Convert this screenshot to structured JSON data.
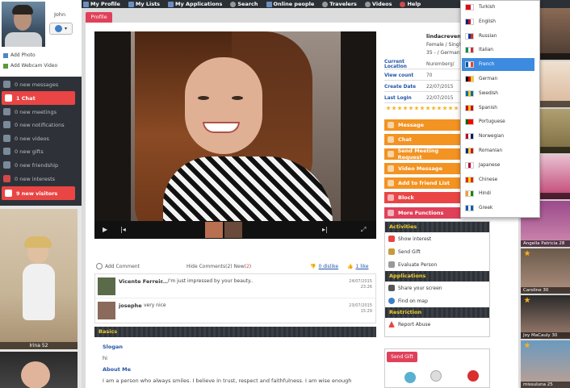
{
  "nav": {
    "items": [
      {
        "label": "My Profile",
        "icon": "user-icon"
      },
      {
        "label": "My Lists",
        "icon": "list-icon"
      },
      {
        "label": "My Applications",
        "icon": "apps-icon"
      },
      {
        "label": "Search",
        "icon": "search-icon"
      },
      {
        "label": "Online people",
        "icon": "people-icon"
      },
      {
        "label": "Travelers",
        "icon": "plane-icon"
      },
      {
        "label": "Videos",
        "icon": "video-icon"
      },
      {
        "label": "Help",
        "icon": "help-icon"
      }
    ]
  },
  "user": {
    "name": "John",
    "add_photo": "Add Photo",
    "add_webcam": "Add Webcam Video"
  },
  "menu": {
    "items": [
      {
        "label": "0 new messages",
        "highlight": false
      },
      {
        "label": "1 Chat",
        "highlight": true
      },
      {
        "label": "0 new meetings",
        "highlight": false
      },
      {
        "label": "0 new notifications",
        "highlight": false
      },
      {
        "label": "0 new videos",
        "highlight": false
      },
      {
        "label": "0 new gifts",
        "highlight": false
      },
      {
        "label": "0 new friendship",
        "highlight": false
      },
      {
        "label": "0 new interests",
        "highlight": false
      },
      {
        "label": "9 new visitors",
        "highlight": true
      }
    ]
  },
  "left_thumbs": [
    {
      "caption": "Irina 52"
    }
  ],
  "profile": {
    "tab": "Profile",
    "name": "lindacreven",
    "line1": "Female / Single",
    "line2": "35 - / Germany",
    "fields": [
      {
        "key": "Current Location",
        "value": "Nuremberg/"
      },
      {
        "key": "View count",
        "value": "70"
      },
      {
        "key": "Create Date",
        "value": "22/07/2015"
      },
      {
        "key": "Last Login",
        "value": "22/07/2015"
      }
    ]
  },
  "actions": [
    {
      "label": "Message",
      "style": "orange",
      "icon": "message-icon"
    },
    {
      "label": "Chat",
      "style": "orange",
      "icon": "chat-icon"
    },
    {
      "label": "Send Meeting Request",
      "style": "orange",
      "icon": "meeting-icon"
    },
    {
      "label": "Video Message",
      "style": "orange",
      "icon": "video-message-icon"
    },
    {
      "label": "Add to friend List",
      "style": "orange",
      "icon": "add-friend-icon"
    },
    {
      "label": "Block",
      "style": "red",
      "icon": "block-icon"
    },
    {
      "label": "More Functions",
      "style": "more",
      "icon": "more-icon"
    }
  ],
  "activities": {
    "title": "Activities",
    "items": [
      "Show interest",
      "Send Gift",
      "Evaluate Person"
    ]
  },
  "applications": {
    "title": "Applications",
    "items": [
      "Share your screen",
      "Find on map"
    ]
  },
  "restriction": {
    "title": "Restriction",
    "items": [
      "Report Abuse"
    ]
  },
  "send_gift": "Send Gift",
  "comment_bar": {
    "add": "Add Comment",
    "hide": "Hide Comments(",
    "count": "2",
    "new_label": ") New(",
    "new_count": "2",
    "close": ")",
    "dislike": "0 dislike",
    "like": "1 like"
  },
  "comments": [
    {
      "name": "Vicente Ferreir...",
      "text": "I'm just impressed by your beauty..",
      "date": "24/07/2015",
      "time": "23:26"
    },
    {
      "name": "josephe",
      "text": "very nice",
      "date": "23/07/2015",
      "time": "15:29"
    }
  ],
  "basics": {
    "title": "Basics",
    "slogan_label": "Slogan",
    "slogan": "hi",
    "about_label": "About Me",
    "about": "I am a person who always smiles. I believe in trust, respect and faithfulness. I am wise enough"
  },
  "right_list": [
    {
      "caption": "Offer"
    },
    {
      "caption": "Offer"
    },
    {
      "caption": "Offer"
    },
    {
      "caption": "Offer"
    },
    {
      "caption": "Offer"
    },
    {
      "caption": "Angella Patricia 28"
    },
    {
      "caption": "Caroline 30"
    },
    {
      "caption": "Joy MaCauly 30"
    },
    {
      "caption": "missuluna 25"
    }
  ],
  "languages": {
    "items": [
      {
        "label": "Turkish",
        "flag": [
          "#e30a17",
          "#e30a17",
          "#fff"
        ]
      },
      {
        "label": "English",
        "flag": [
          "#012169",
          "#c8102e",
          "#fff"
        ]
      },
      {
        "label": "Russian",
        "flag": [
          "#fff",
          "#0039a6",
          "#d52b1e"
        ]
      },
      {
        "label": "Italian",
        "flag": [
          "#009246",
          "#fff",
          "#ce2b37"
        ]
      },
      {
        "label": "French",
        "flag": [
          "#0055a4",
          "#fff",
          "#ef4135"
        ]
      },
      {
        "label": "German",
        "flag": [
          "#000",
          "#dd0000",
          "#ffce00"
        ]
      },
      {
        "label": "Swedish",
        "flag": [
          "#006aa7",
          "#fecc00",
          "#006aa7"
        ]
      },
      {
        "label": "Spanish",
        "flag": [
          "#c60b1e",
          "#ffc400",
          "#c60b1e"
        ]
      },
      {
        "label": "Portuguese",
        "flag": [
          "#006600",
          "#ff0000",
          "#ff0000"
        ]
      },
      {
        "label": "Norwegian",
        "flag": [
          "#ba0c2f",
          "#fff",
          "#00205b"
        ]
      },
      {
        "label": "Romanian",
        "flag": [
          "#002b7f",
          "#fcd116",
          "#ce1126"
        ]
      },
      {
        "label": "Japanese",
        "flag": [
          "#fff",
          "#bc002d",
          "#fff"
        ]
      },
      {
        "label": "Chinese",
        "flag": [
          "#de2910",
          "#ffde00",
          "#de2910"
        ]
      },
      {
        "label": "Hindi",
        "flag": [
          "#ff9933",
          "#fff",
          "#138808"
        ]
      },
      {
        "label": "Greek",
        "flag": [
          "#0d5eaf",
          "#fff",
          "#0d5eaf"
        ]
      }
    ],
    "selected": "French"
  },
  "colors": {
    "accent_orange": "#f39322",
    "accent_red": "#e94545",
    "accent_pink": "#e0415a",
    "dark": "#2e3238",
    "link_blue": "#2456a8"
  }
}
